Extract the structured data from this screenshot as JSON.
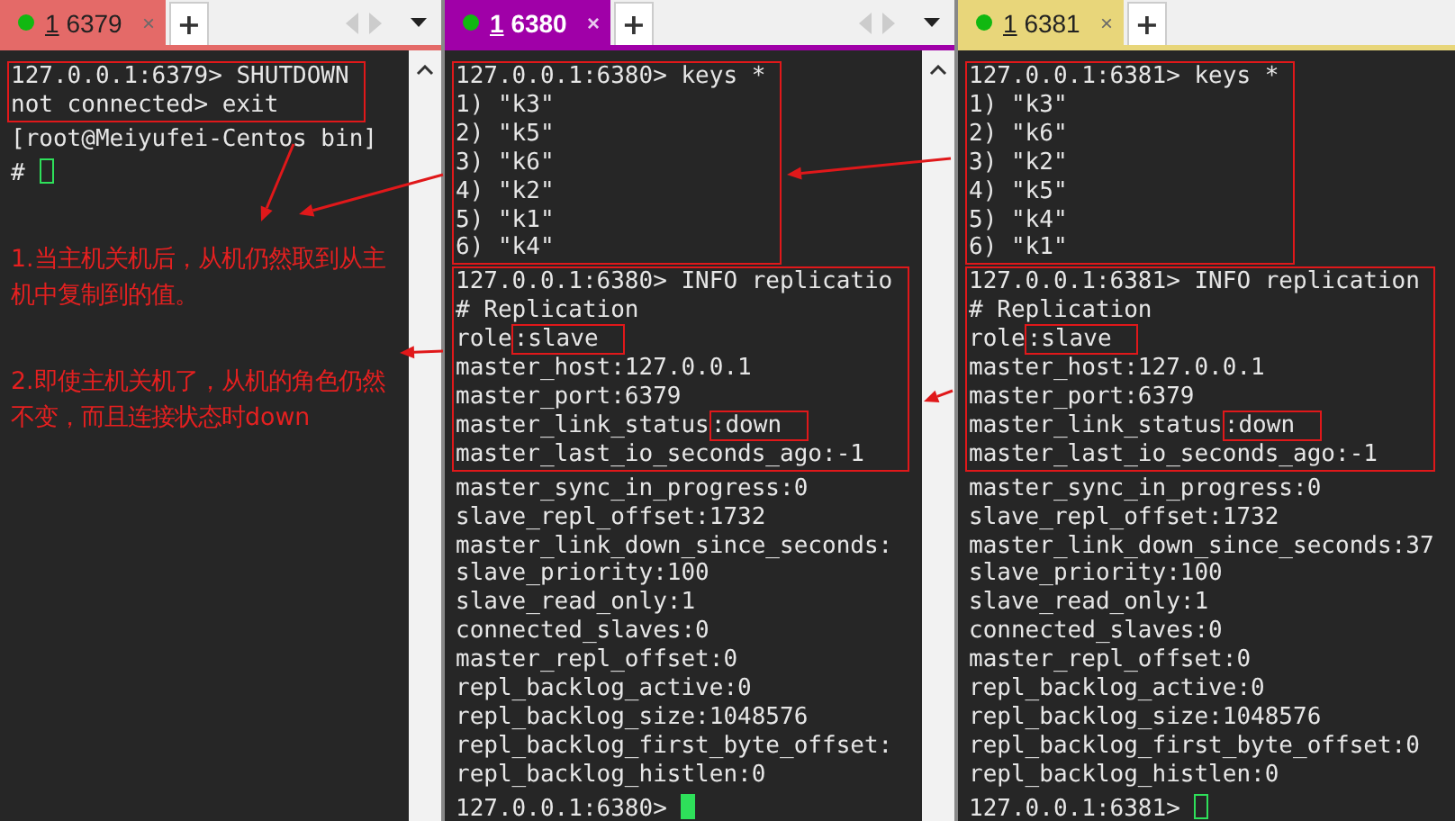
{
  "panes": [
    {
      "tab": {
        "number": "1",
        "title": "6379",
        "close": "×",
        "color": "#e46a68",
        "selected": false
      },
      "new_tab": "+",
      "tab_controls": true,
      "scrollbar": true,
      "blocks": [
        {
          "boxed": true,
          "lines": [
            {
              "text": "127.0.0.1:6379> SHUTDOWN"
            },
            {
              "text": "not connected> exit"
            }
          ]
        },
        {
          "boxed": false,
          "lines": [
            {
              "text": "[root@Meiyufei-Centos bin]"
            }
          ]
        }
      ],
      "prompt": "# ",
      "cursor_filled": false,
      "notes": [
        "1.当主机关机后，从机仍然取到从主机中复制到的值。",
        "2.即使主机关机了，从机的角色仍然不变，而且连接状态时down"
      ]
    },
    {
      "tab": {
        "number": "1",
        "title": "6380",
        "close": "×",
        "color": "#a000a8",
        "selected": true
      },
      "new_tab": "+",
      "tab_controls": true,
      "scrollbar": true,
      "blocks": [
        {
          "boxed": true,
          "lines": [
            {
              "text": "127.0.0.1:6380> keys *"
            },
            {
              "text": "1) \"k3\""
            },
            {
              "text": "2) \"k5\""
            },
            {
              "text": "3) \"k6\""
            },
            {
              "text": "4) \"k2\""
            },
            {
              "text": "5) \"k1\""
            },
            {
              "text": "6) \"k4\""
            }
          ]
        },
        {
          "boxed": true,
          "lines": [
            {
              "text": "127.0.0.1:6380> INFO replicatio"
            },
            {
              "text": "# Replication"
            },
            {
              "text": "role",
              "highlight": ":slave"
            },
            {
              "text": "master_host:127.0.0.1"
            },
            {
              "text": "master_port:6379"
            },
            {
              "text": "master_link_status",
              "highlight": ":down"
            },
            {
              "text": "master_last_io_seconds_ago:-1"
            }
          ]
        },
        {
          "boxed": false,
          "lines": [
            {
              "text": "master_sync_in_progress:0"
            },
            {
              "text": "slave_repl_offset:1732"
            },
            {
              "text": "master_link_down_since_seconds:"
            },
            {
              "text": "slave_priority:100"
            },
            {
              "text": "slave_read_only:1"
            },
            {
              "text": "connected_slaves:0"
            },
            {
              "text": "master_repl_offset:0"
            },
            {
              "text": "repl_backlog_active:0"
            },
            {
              "text": "repl_backlog_size:1048576"
            },
            {
              "text": "repl_backlog_first_byte_offset:"
            },
            {
              "text": "repl_backlog_histlen:0"
            }
          ]
        }
      ],
      "prompt": "127.0.0.1:6380> ",
      "cursor_filled": true
    },
    {
      "tab": {
        "number": "1",
        "title": "6381",
        "close": "×",
        "color": "#e8d67a",
        "selected": false
      },
      "new_tab": "+",
      "tab_controls": false,
      "scrollbar": false,
      "blocks": [
        {
          "boxed": true,
          "lines": [
            {
              "text": "127.0.0.1:6381> keys *"
            },
            {
              "text": "1) \"k3\""
            },
            {
              "text": "2) \"k6\""
            },
            {
              "text": "3) \"k2\""
            },
            {
              "text": "4) \"k5\""
            },
            {
              "text": "5) \"k4\""
            },
            {
              "text": "6) \"k1\""
            }
          ]
        },
        {
          "boxed": true,
          "lines": [
            {
              "text": "127.0.0.1:6381> INFO replication"
            },
            {
              "text": "# Replication"
            },
            {
              "text": "role",
              "highlight": ":slave"
            },
            {
              "text": "master_host:127.0.0.1"
            },
            {
              "text": "master_port:6379"
            },
            {
              "text": "master_link_status",
              "highlight": ":down"
            },
            {
              "text": "master_last_io_seconds_ago:-1"
            }
          ]
        },
        {
          "boxed": false,
          "lines": [
            {
              "text": "master_sync_in_progress:0"
            },
            {
              "text": "slave_repl_offset:1732"
            },
            {
              "text": "master_link_down_since_seconds:37"
            },
            {
              "text": "slave_priority:100"
            },
            {
              "text": "slave_read_only:1"
            },
            {
              "text": "connected_slaves:0"
            },
            {
              "text": "master_repl_offset:0"
            },
            {
              "text": "repl_backlog_active:0"
            },
            {
              "text": "repl_backlog_size:1048576"
            },
            {
              "text": "repl_backlog_first_byte_offset:0"
            },
            {
              "text": "repl_backlog_histlen:0"
            }
          ]
        }
      ],
      "prompt": "127.0.0.1:6381> ",
      "cursor_filled": false
    }
  ]
}
